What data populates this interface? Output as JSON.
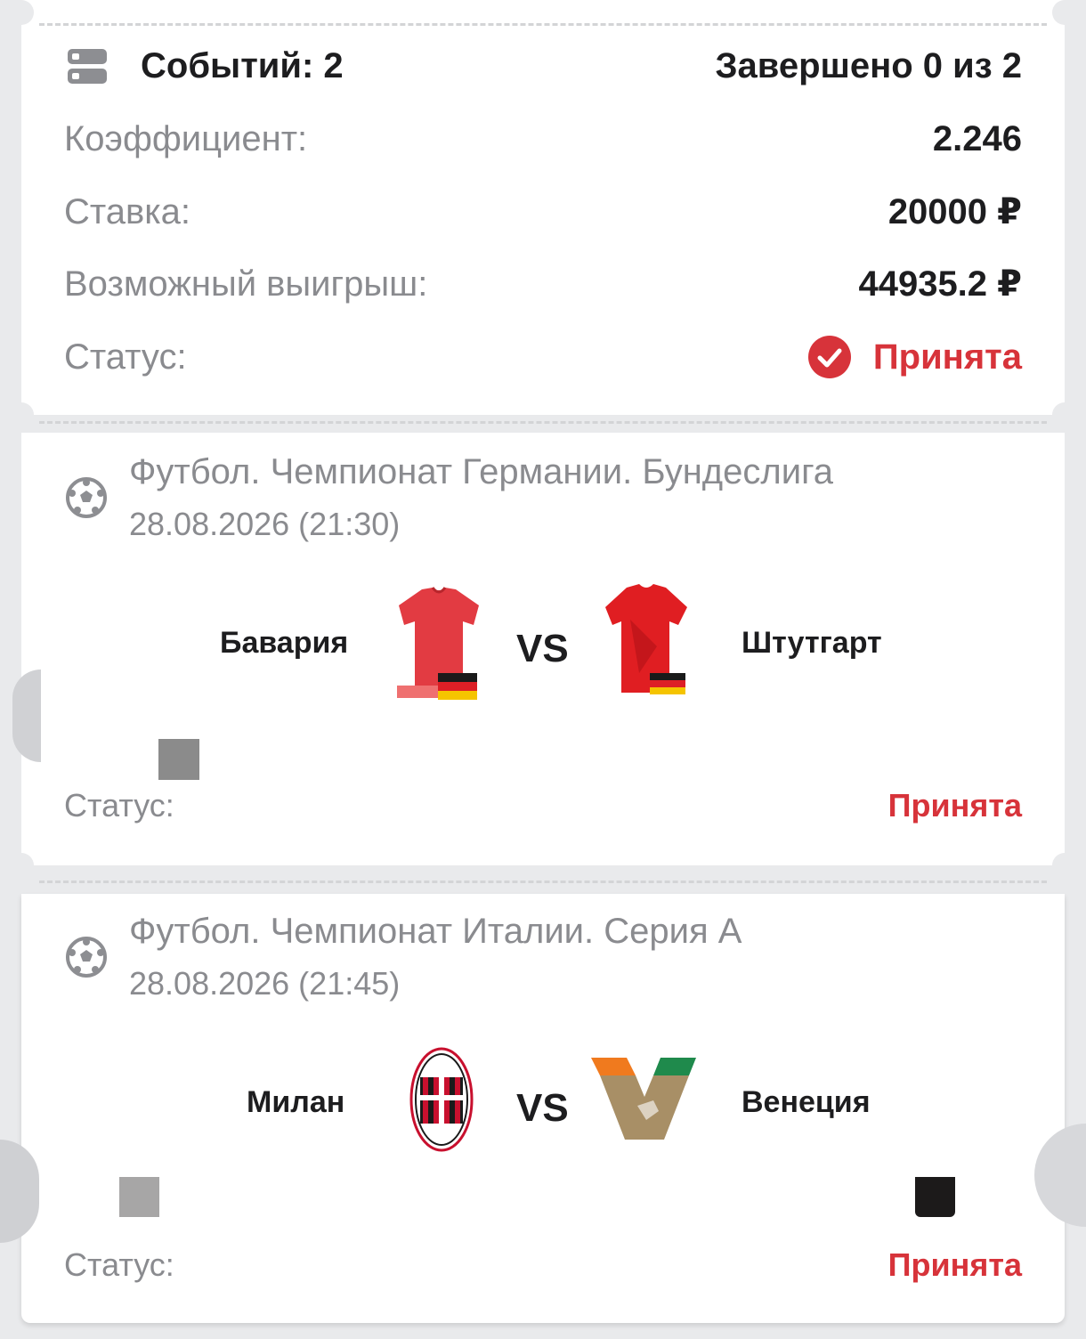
{
  "summary": {
    "events_label": "Событий: 2",
    "completed_label": "Завершено 0 из 2",
    "coef_label": "Коэффициент:",
    "coef_value": "2.246",
    "stake_label": "Ставка:",
    "stake_value": "20000 ₽",
    "win_label": "Возможный выигрыш:",
    "win_value": "44935.2 ₽",
    "status_label": "Статус:",
    "status_value": "Принята"
  },
  "events": [
    {
      "league": "Футбол. Чемпионат Германии. Бундеслига",
      "date": "28.08.2026 (21:30)",
      "home": "Бавария",
      "vs": "VS",
      "away": "Штутгарт",
      "status_label": "Статус:",
      "status_value": "Принята"
    },
    {
      "league": "Футбол. Чемпионат Италии. Серия А",
      "date": "28.08.2026 (21:45)",
      "home": "Милан",
      "vs": "VS",
      "away": "Венеция",
      "status_label": "Статус:",
      "status_value": "Принята"
    }
  ],
  "colors": {
    "accent": "#d7333a",
    "muted": "#8a8b8f",
    "text": "#1d1d1f"
  },
  "icons": [
    "events-list-icon",
    "check-circle-icon",
    "soccer-ball-icon",
    "jersey-icon",
    "team-logo-icon"
  ]
}
